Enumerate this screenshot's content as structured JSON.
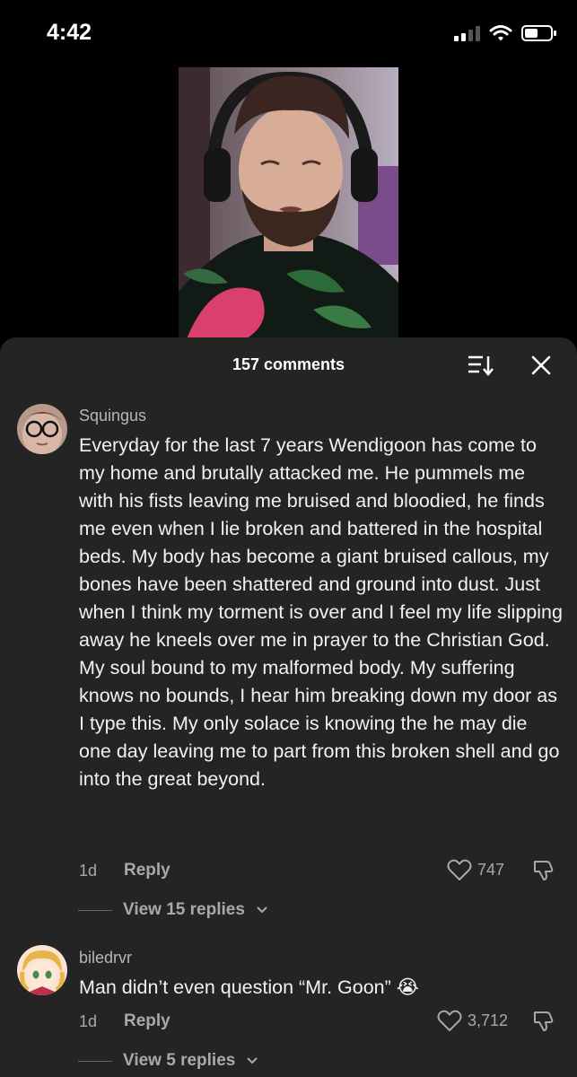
{
  "status_bar": {
    "time": "4:42"
  },
  "comments_panel": {
    "count_label": "157 comments",
    "comments": [
      {
        "username": "Squingus",
        "text": "Everyday for the last 7 years Wendigoon has come to my home and brutally attacked me. He pummels me with his fists leaving me bruised and bloodied, he finds me even when I lie broken and battered in the hospital beds. My body has become a giant bruised callous, my bones have been shattered and ground into dust. Just when I think my torment is over and I feel my life slipping away he kneels over me in prayer to the Christian God. My soul bound to my malformed body. My suffering knows no bounds, I hear him breaking down my door as I type this. My only solace is knowing the he may die one day leaving me to part from this broken shell and go into the great beyond.",
        "age": "1d",
        "reply_label": "Reply",
        "likes": "747",
        "view_replies": "View 15 replies"
      },
      {
        "username": "biledrvr",
        "text": "Man didn’t even question “Mr. Goon”",
        "emoji": "😭",
        "age": "1d",
        "reply_label": "Reply",
        "likes": "3,712",
        "view_replies": "View 5 replies"
      }
    ]
  }
}
